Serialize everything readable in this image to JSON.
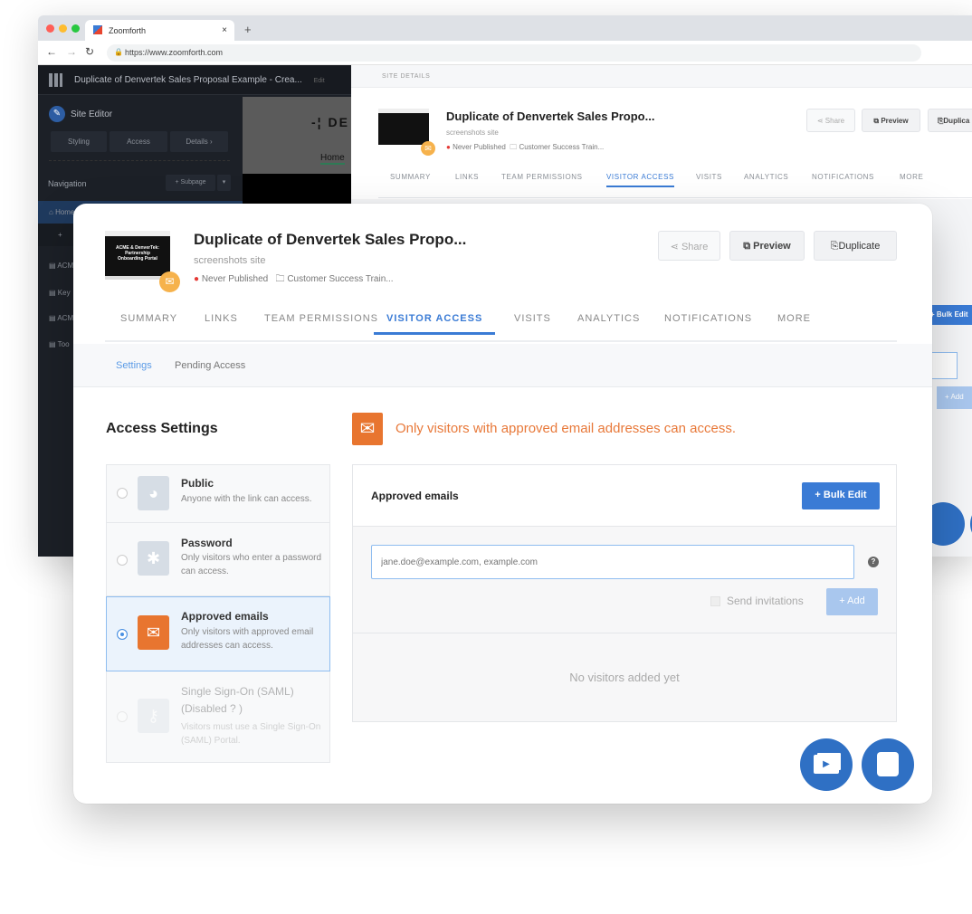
{
  "browser": {
    "tab_title": "Zoomforth",
    "url": "https://www.zoomforth.com",
    "colors": {
      "close": "#ff5f57",
      "minimize": "#febc2e",
      "maximize": "#28c840"
    }
  },
  "background_app": {
    "header_title": "Duplicate of Denvertek Sales Proposal Example - Crea...",
    "header_edit": "Edit",
    "site_editor": "Site Editor",
    "editor_buttons": [
      "Styling",
      "Access",
      "Details ›"
    ],
    "navigation_label": "Navigation",
    "subpage_button": "+ Subpage",
    "nav_items": [
      "Home",
      "+",
      "ACME",
      "Key",
      "ACME",
      "Too"
    ],
    "preview_logo": "DE",
    "preview_home": "Home",
    "site_details_label": "SITE DETAILS",
    "title": "Duplicate of Denvertek Sales Propo...",
    "subtitle": "screenshots site",
    "status": "Never Published",
    "folder": "Customer Success Train...",
    "share": "Share",
    "preview": "Preview",
    "duplicate": "Duplica",
    "tabs": [
      "SUMMARY",
      "LINKS",
      "TEAM PERMISSIONS",
      "VISITOR ACCESS",
      "VISITS",
      "ANALYTICS",
      "NOTIFICATIONS",
      "MORE"
    ],
    "bulk_edit": "Bulk Edit",
    "add": "+ Add"
  },
  "card": {
    "thumbnail_text": "ACME & DenverTek: Partnership Onboarding Portal",
    "title": "Duplicate of Denvertek Sales Propo...",
    "subtitle": "screenshots site",
    "status": "Never Published",
    "folder": "Customer Success Train...",
    "share": "Share",
    "preview": "Preview",
    "duplicate": "Duplicate",
    "tabs": [
      "SUMMARY",
      "LINKS",
      "TEAM PERMISSIONS",
      "VISITOR ACCESS",
      "VISITS",
      "ANALYTICS",
      "NOTIFICATIONS",
      "MORE"
    ],
    "active_tab": "VISITOR ACCESS",
    "subtabs": [
      "Settings",
      "Pending Access"
    ],
    "access_settings_title": "Access Settings",
    "options": [
      {
        "title": "Public",
        "desc": "Anyone with the link can access.",
        "selected": false
      },
      {
        "title": "Password",
        "desc": "Only visitors who enter a password can access.",
        "selected": false
      },
      {
        "title": "Approved emails",
        "desc": "Only visitors with approved email addresses can access.",
        "selected": true
      },
      {
        "title": "Single Sign-On (SAML) (Disabled ? )",
        "desc": "Visitors must use a Single Sign-On (SAML) Portal.",
        "selected": false
      }
    ],
    "notice": "Only visitors with approved email addresses can access.",
    "panel_title": "Approved emails",
    "bulk_edit": "+ Bulk Edit",
    "email_placeholder": "jane.doe@example.com, example.com",
    "send_invitations": "Send invitations",
    "add": "+ Add",
    "empty": "No visitors added yet"
  },
  "colors": {
    "accent": "#3a7bd5",
    "orange": "#e8752f",
    "badge": "#f6b24c",
    "dark": "#1c2027"
  }
}
